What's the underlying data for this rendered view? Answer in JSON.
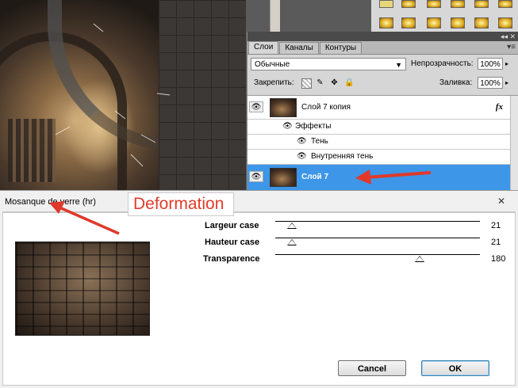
{
  "colors": {
    "arrow_red": "#e0392a",
    "selected_layer_bg": "#3d96e8",
    "annotation_text": "#e13a2a"
  },
  "layers_panel": {
    "tabs": [
      {
        "label": "Слои",
        "active": true
      },
      {
        "label": "Каналы",
        "active": false
      },
      {
        "label": "Контуры",
        "active": false
      }
    ],
    "blend_mode": "Обычные",
    "opacity_label": "Непрозрачность:",
    "opacity_value": "100%",
    "lock_label": "Закрепить:",
    "fill_label": "Заливка:",
    "fill_value": "100%",
    "layers": [
      {
        "name": "Слой 7 копия",
        "fx": "fx",
        "selected": false
      },
      {
        "name": "Эффекты"
      },
      {
        "name": "Тень"
      },
      {
        "name": "Внутренняя тень"
      },
      {
        "name": "Слой 7",
        "selected": true
      }
    ]
  },
  "filter_dialog": {
    "title": "Mosanque de verre (hr)",
    "close_label": "✕",
    "params": [
      {
        "label": "Largeur case",
        "value": "21",
        "level": 21,
        "max": 255
      },
      {
        "label": "Hauteur case",
        "value": "21",
        "level": 21,
        "max": 255
      },
      {
        "label": "Transparence",
        "value": "180",
        "level": 180,
        "max": 255
      }
    ],
    "cancel_label": "Cancel",
    "ok_label": "OK"
  },
  "annotations": {
    "deformation_label": "Deformation"
  }
}
